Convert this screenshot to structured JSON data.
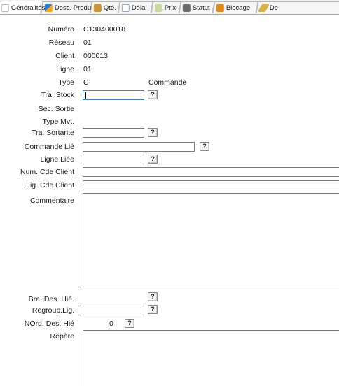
{
  "tabs": [
    {
      "label": "Généralités",
      "icon": "general-icon",
      "active": true
    },
    {
      "label": "Desc. Produit",
      "icon": "product-description-icon"
    },
    {
      "label": "Qté.",
      "icon": "quantity-icon"
    },
    {
      "label": "Délai",
      "icon": "clock-icon"
    },
    {
      "label": "Prix",
      "icon": "price-icon"
    },
    {
      "label": "Statut",
      "icon": "status-icon"
    },
    {
      "label": "Blocage",
      "icon": "lock-icon"
    },
    {
      "label": "De",
      "icon": "pencil-icon"
    }
  ],
  "form": {
    "numero": {
      "label": "Numéro",
      "value": "C130400018"
    },
    "reseau": {
      "label": "Réseau",
      "value": "01"
    },
    "client": {
      "label": "Client",
      "value": "000013"
    },
    "ligne": {
      "label": "Ligne",
      "value": "01"
    },
    "type": {
      "label": "Type",
      "value": "C",
      "description": "Commande"
    },
    "tra_stock": {
      "label": "Tra. Stock",
      "value": ""
    },
    "sec_sortie": {
      "label": "Sec. Sortie"
    },
    "type_mvt": {
      "label": "Type Mvt."
    },
    "tra_sortante": {
      "label": "Tra. Sortante",
      "value": ""
    },
    "commande_lie": {
      "label": "Commande Lié",
      "value": ""
    },
    "ligne_liee": {
      "label": "Ligne Liée",
      "value": ""
    },
    "num_cde_client": {
      "label": "Num. Cde Client",
      "value": ""
    },
    "lig_cde_client": {
      "label": "Lig. Cde Client",
      "value": ""
    },
    "commentaire": {
      "label": "Commentaire",
      "value": ""
    },
    "bra_des_hie": {
      "label": "Bra. Des. Hié."
    },
    "regroup_lig": {
      "label": "Regroup.Lig.",
      "value": ""
    },
    "nord_des_hie": {
      "label": "NOrd. Des. Hié",
      "value": "0"
    },
    "repere": {
      "label": "Repère",
      "value": ""
    }
  },
  "lookup_button_label": "?"
}
